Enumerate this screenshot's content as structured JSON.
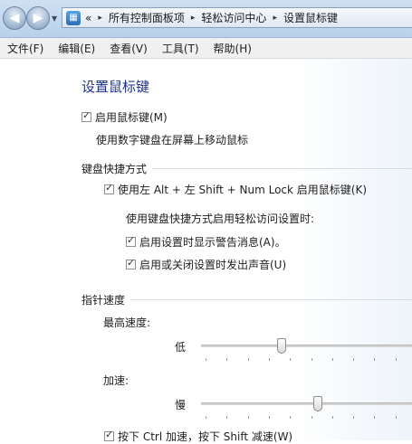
{
  "address": {
    "prefix": "«",
    "crumbs": [
      "所有控制面板项",
      "轻松访问中心",
      "设置鼠标键"
    ]
  },
  "menu": [
    "文件(F)",
    "编辑(E)",
    "查看(V)",
    "工具(T)",
    "帮助(H)"
  ],
  "page": {
    "title": "设置鼠标键",
    "enable_mousekeys": {
      "label": "启用鼠标键(M)",
      "checked": true
    },
    "enable_desc": "使用数字键盘在屏幕上移动鼠标"
  },
  "shortcut": {
    "header": "键盘快捷方式",
    "use_shortcut": {
      "label": "使用左 Alt + 左 Shift + Num Lock 启用鼠标键(K)",
      "checked": true
    },
    "sub_label": "使用键盘快捷方式启用轻松访问设置时:",
    "warning": {
      "label": "启用设置时显示警告消息(A)。",
      "checked": true
    },
    "sound": {
      "label": "启用或关闭设置时发出声音(U)",
      "checked": true
    }
  },
  "speed": {
    "header": "指针速度",
    "top_label": "最高速度:",
    "top_min": "低",
    "top_value": 0.38,
    "accel_label": "加速:",
    "accel_min": "慢",
    "accel_value": 0.55,
    "ctrl_shift": {
      "label": "按下 Ctrl 加速，按下 Shift 减速(W)",
      "checked": true
    }
  }
}
